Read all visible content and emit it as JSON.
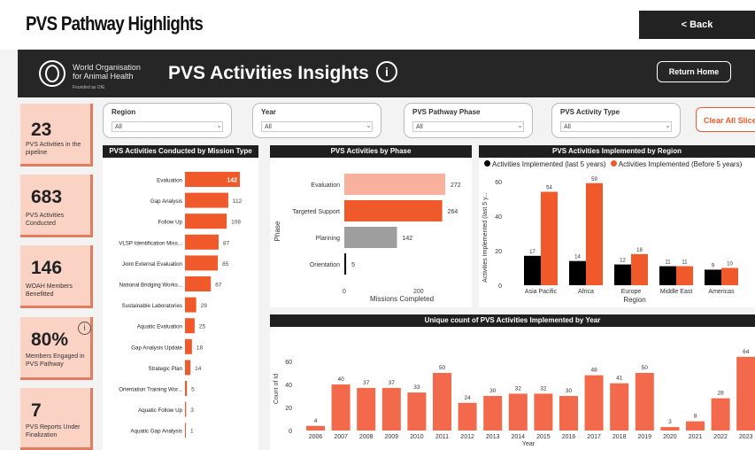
{
  "page": {
    "title": "PVS Pathway Highlights",
    "back_label": "< Back"
  },
  "header": {
    "org_line1": "World Organisation",
    "org_line2": "for Animal Health",
    "org_line3": "Founded as OIE",
    "title": "PVS Activities Insights",
    "info_glyph": "i",
    "return_label": "Return Home"
  },
  "kpis": [
    {
      "value": "23",
      "label": "PVS Activities in the pipeline"
    },
    {
      "value": "683",
      "label": "PVS Activities Conducted"
    },
    {
      "value": "146",
      "label": "WOAH Members Benefitted"
    },
    {
      "value": "80%",
      "label": "Members Engaged in PVS Pathway"
    },
    {
      "value": "7",
      "label": "PVS Reports Under Finalization"
    }
  ],
  "filters": [
    {
      "label": "Region",
      "value": "All"
    },
    {
      "label": "Year",
      "value": "All"
    },
    {
      "label": "PVS Pathway Phase",
      "value": "All"
    },
    {
      "label": "PVS Activity Type",
      "value": "All"
    }
  ],
  "clear_label": "Clear All Slicers",
  "colors": {
    "accent": "#f05a2a",
    "dark": "#1f1f1f",
    "kpi_bg": "#fbd3c5",
    "year_bar": "#f26a4b",
    "light_orange": "#f7b19c",
    "grey": "#9e9e9e"
  },
  "chart_data": [
    {
      "type": "bar",
      "title": "PVS Activities Conducted by Mission Type",
      "orientation": "horizontal",
      "categories": [
        "Evaluation",
        "Gap Analysis",
        "Follow Up",
        "VLSP Identification Miss...",
        "Joint External Evaluation",
        "National Bridging Works...",
        "Sustainable Laboratories",
        "Aquatic Evaluation",
        "Gap Analysis Update",
        "Strategic Plan",
        "Orientation Training Wor...",
        "Aquatic Follow Up",
        "Aquatic Gap Analysis"
      ],
      "values": [
        142,
        112,
        108,
        87,
        85,
        67,
        29,
        25,
        18,
        14,
        5,
        3,
        1
      ],
      "xlim": [
        0,
        150
      ]
    },
    {
      "type": "bar",
      "title": "PVS Activities by Phase",
      "orientation": "horizontal",
      "categories": [
        "Evaluation",
        "Targeted Support",
        "Planning",
        "Orientation"
      ],
      "values": [
        272,
        264,
        142,
        5
      ],
      "xlabel": "Missions Completed",
      "ylabel": "Phase",
      "ticks": [
        "0",
        "200"
      ],
      "xlim": [
        0,
        300
      ]
    },
    {
      "type": "bar",
      "title": "PVS Activities Implemented by Region",
      "categories": [
        "Asia Pacific",
        "Africa",
        "Europe",
        "Middle East",
        "Americas"
      ],
      "series": [
        {
          "name": "Activities Implemented (last 5 years)",
          "values": [
            17,
            14,
            12,
            11,
            9
          ],
          "color": "#000000"
        },
        {
          "name": "Activities Implemented (Before 5 years)",
          "values": [
            54,
            59,
            18,
            11,
            10
          ],
          "color": "#f05a2a"
        }
      ],
      "xlabel": "Region",
      "ylabel": "Activities Implemented (last 5 y...",
      "yticks": [
        "0",
        "20",
        "40",
        "60"
      ],
      "ylim": [
        0,
        64
      ]
    },
    {
      "type": "bar",
      "title": "Unique count of PVS Activities Implemented by Year",
      "categories": [
        "2006",
        "2007",
        "2008",
        "2009",
        "2010",
        "2011",
        "2012",
        "2013",
        "2014",
        "2015",
        "2016",
        "2017",
        "2018",
        "2019",
        "2020",
        "2021",
        "2022",
        "2023"
      ],
      "values": [
        4,
        40,
        37,
        37,
        33,
        50,
        24,
        30,
        32,
        32,
        30,
        48,
        41,
        50,
        3,
        8,
        28,
        64
      ],
      "xlabel": "Year",
      "ylabel": "Count of Id",
      "yticks": [
        "0",
        "20",
        "40",
        "60"
      ],
      "ylim": [
        0,
        70
      ]
    }
  ]
}
